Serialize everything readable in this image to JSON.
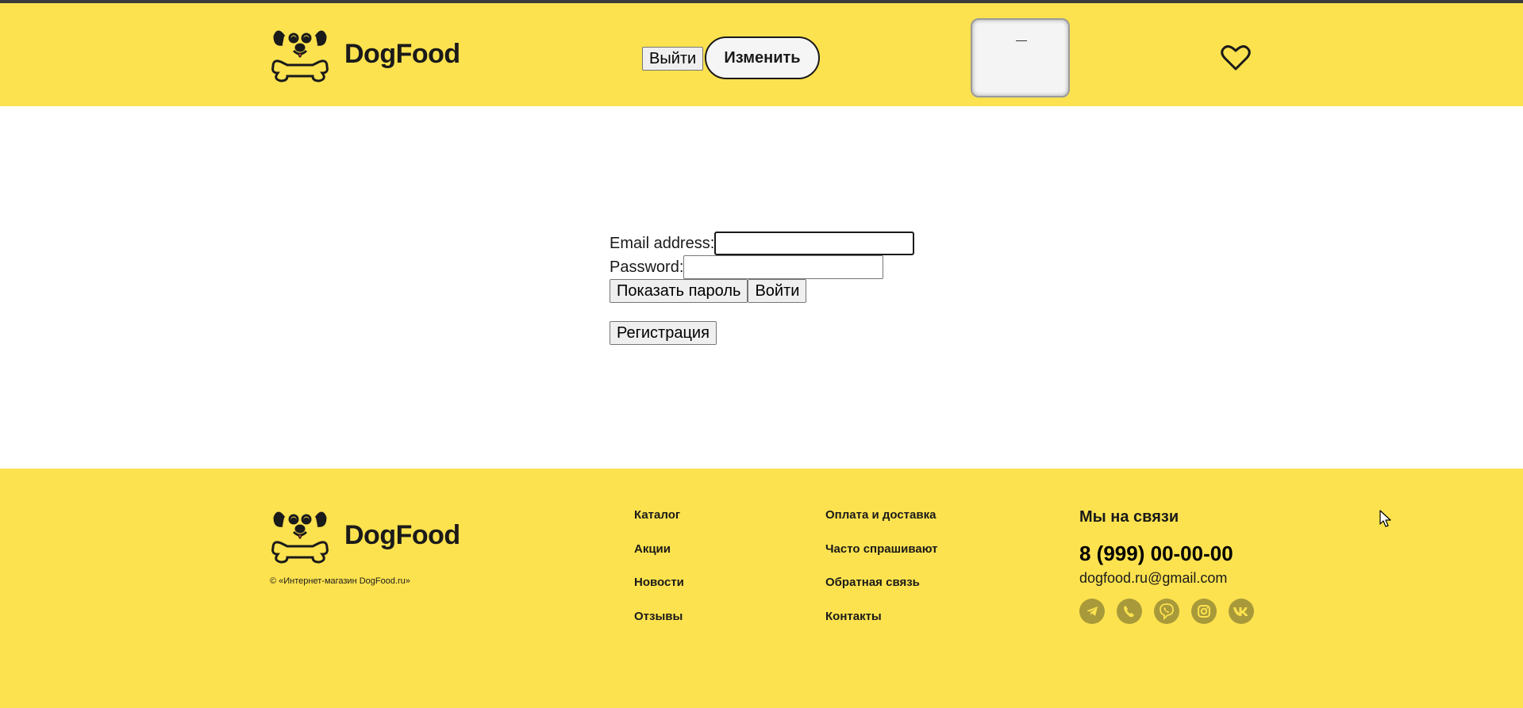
{
  "header": {
    "logo_text": "DogFood",
    "logout_label": "Выйти",
    "edit_label": "Изменить",
    "modal_text": "—",
    "heart_icon": "heart-icon"
  },
  "login_form": {
    "email_label": "Email address:",
    "email_value": "",
    "password_label": "Password:",
    "password_value": "",
    "show_password_label": "Показать пароль",
    "login_label": "Войти",
    "register_label": "Регистрация"
  },
  "footer": {
    "logo_text": "DogFood",
    "copyright": "© «Интернет-магазин DogFood.ru»",
    "links_col1": [
      "Каталог",
      "Акции",
      "Новости",
      "Отзывы"
    ],
    "links_col2": [
      "Оплата и доставка",
      "Часто спрашивают",
      "Обратная связь",
      "Контакты"
    ],
    "contact_title": "Мы на связи",
    "phone": "8 (999) 00-00-00",
    "email": "dogfood.ru@gmail.com",
    "socials": [
      "telegram-icon",
      "whatsapp-icon",
      "viber-icon",
      "instagram-icon",
      "vk-icon"
    ]
  },
  "colors": {
    "brand_yellow": "#fde24f",
    "text_dark": "#1a1a1a",
    "social_bg": "#a89a3a"
  }
}
